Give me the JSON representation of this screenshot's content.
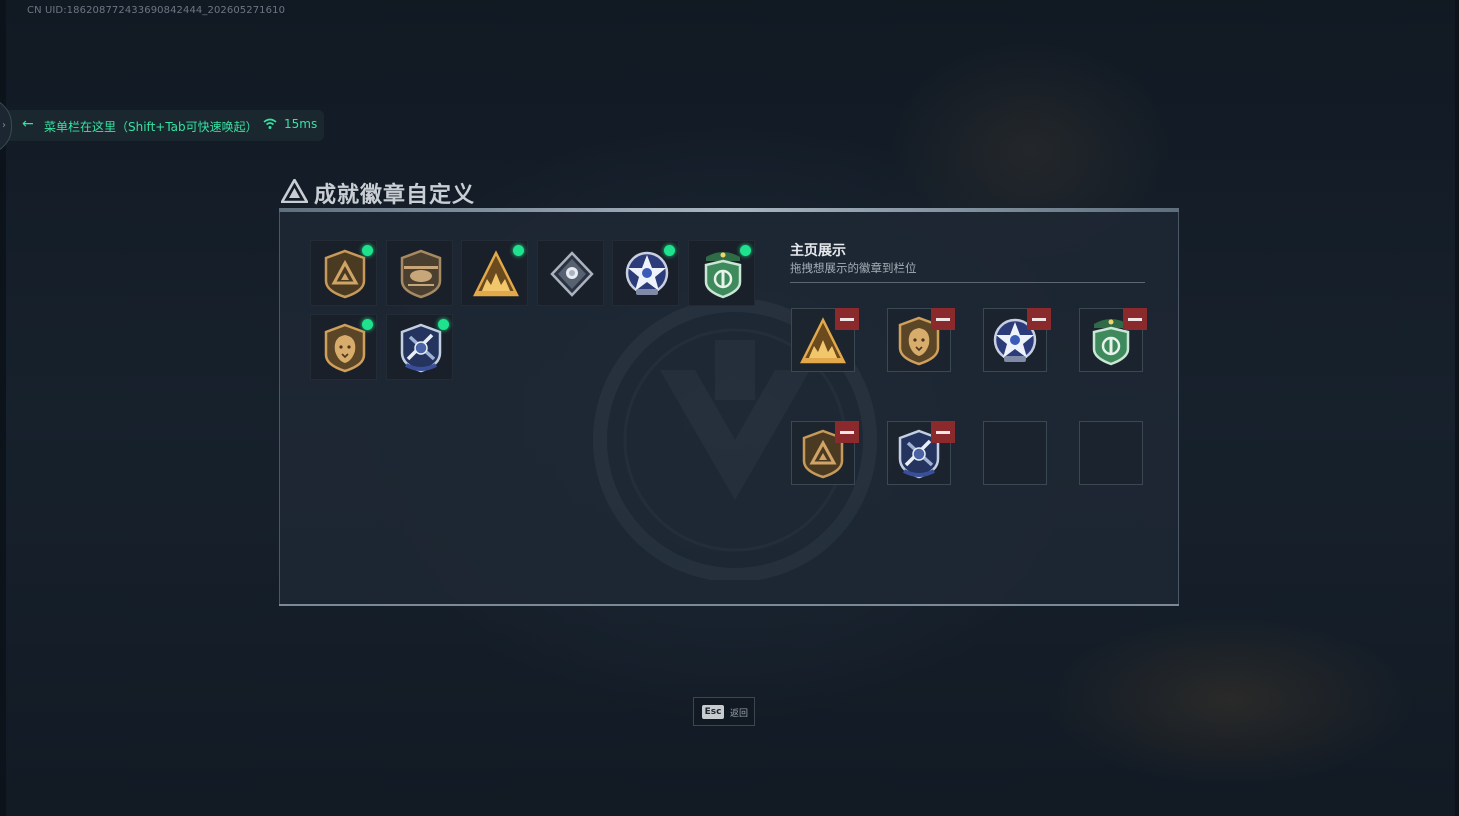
{
  "uid_text": "CN UID:18620877243369084244​4_202605271610",
  "menu": {
    "text": "菜单栏在这里（Shift+Tab可快速唤起）",
    "ping": "15ms",
    "accent_color": "#35e3a2"
  },
  "panel": {
    "title": "成就徽章自定义"
  },
  "badges": [
    {
      "icon": "gold-triangle-shield-icon",
      "new": true
    },
    {
      "icon": "helicopter-shield-icon",
      "new": false
    },
    {
      "icon": "mountain-soldiers-icon",
      "new": true
    },
    {
      "icon": "diamond-rose-icon",
      "new": false
    },
    {
      "icon": "blue-star-emblem-icon",
      "new": true
    },
    {
      "icon": "green-beret-shield-icon",
      "new": true
    },
    {
      "icon": "lion-head-shield-icon",
      "new": true
    },
    {
      "icon": "blue-swords-crest-icon",
      "new": true
    }
  ],
  "showcase": {
    "title": "主页展示",
    "subtitle": "拖拽想展示的徽章到栏位",
    "slots": [
      {
        "icon": "mountain-soldiers-icon"
      },
      {
        "icon": "lion-head-shield-icon"
      },
      {
        "icon": "blue-star-emblem-icon"
      },
      {
        "icon": "green-beret-shield-icon"
      },
      {
        "icon": "gold-triangle-shield-icon"
      },
      {
        "icon": "blue-swords-crest-icon"
      },
      {
        "icon": ""
      },
      {
        "icon": ""
      }
    ]
  },
  "footer": {
    "key": "Esc",
    "label": "返回"
  }
}
